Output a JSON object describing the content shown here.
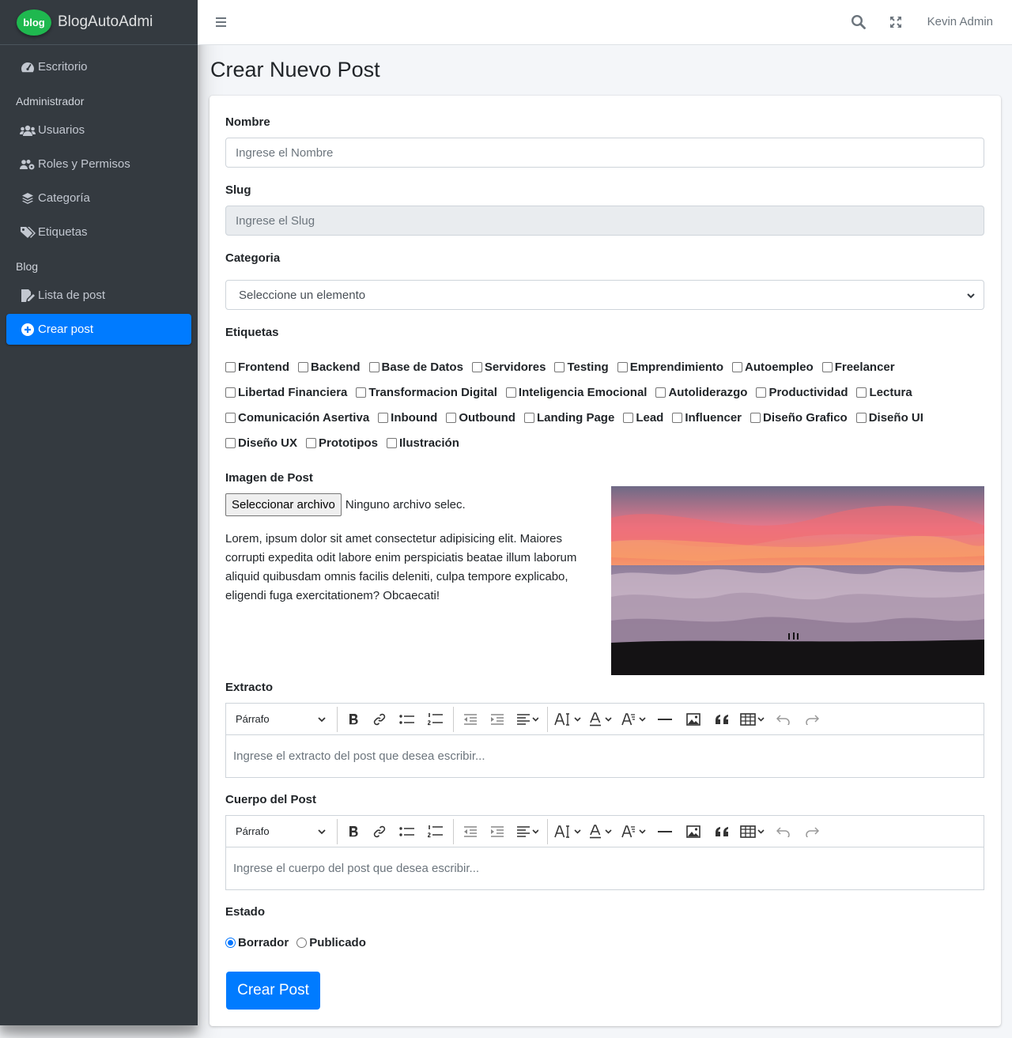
{
  "brand": {
    "logo_text": "blog",
    "name": "BlogAutoAdmi"
  },
  "sidebar": {
    "items": [
      {
        "label": "Escritorio",
        "icon": "tachometer-icon"
      },
      {
        "header": "Administrador"
      },
      {
        "label": "Usuarios",
        "icon": "users-icon"
      },
      {
        "label": "Roles y Permisos",
        "icon": "users-cog-icon"
      },
      {
        "label": "Categoría",
        "icon": "layers-icon"
      },
      {
        "label": "Etiquetas",
        "icon": "tags-icon"
      },
      {
        "header": "Blog"
      },
      {
        "label": "Lista de post",
        "icon": "edit-file-icon"
      },
      {
        "label": "Crear post",
        "icon": "plus-circle-icon",
        "active": true
      }
    ]
  },
  "topbar": {
    "user": "Kevin Admin"
  },
  "page": {
    "title": "Crear Nuevo Post"
  },
  "form": {
    "name": {
      "label": "Nombre",
      "placeholder": "Ingrese el Nombre",
      "value": ""
    },
    "slug": {
      "label": "Slug",
      "placeholder": "Ingrese el Slug",
      "value": ""
    },
    "category": {
      "label": "Categoria",
      "selected": "Seleccione un elemento"
    },
    "tags": {
      "label": "Etiquetas",
      "rows": [
        [
          "Frontend",
          "Backend",
          "Base de Datos",
          "Servidores",
          "Testing",
          "Emprendimiento",
          "Autoempleo",
          "Freelancer"
        ],
        [
          "Libertad Financiera",
          "Transformacion Digital",
          "Inteligencia Emocional",
          "Autoliderazgo",
          "Productividad",
          "Lectura"
        ],
        [
          "Comunicación Asertiva",
          "Inbound",
          "Outbound",
          "Landing Page",
          "Lead",
          "Influencer",
          "Diseño Grafico",
          "Diseño UI"
        ],
        [
          "Diseño UX",
          "Prototipos",
          "Ilustración"
        ]
      ]
    },
    "image": {
      "label": "Imagen de Post",
      "button": "Seleccionar archivo",
      "status": "Ninguno archivo selec.",
      "description": "Lorem, ipsum dolor sit amet consectetur adipisicing elit. Maiores corrupti expedita odit labore enim perspiciatis beatae illum laborum aliquid quibusdam omnis facilis deleniti, culpa tempore explicabo, eligendi fuga exercitationem? Obcaecati!"
    },
    "excerpt": {
      "label": "Extracto",
      "heading_select": "Párrafo",
      "placeholder": "Ingrese el extracto del post que desea escribir..."
    },
    "body": {
      "label": "Cuerpo del Post",
      "heading_select": "Párrafo",
      "placeholder": "Ingrese el cuerpo del post que desea escribir..."
    },
    "status": {
      "label": "Estado",
      "options": [
        "Borrador",
        "Publicado"
      ],
      "selected": "Borrador"
    },
    "submit": "Crear Post"
  },
  "colors": {
    "sidebar_bg": "#343a40",
    "primary": "#007bff",
    "brand_green": "#1fb84f"
  }
}
